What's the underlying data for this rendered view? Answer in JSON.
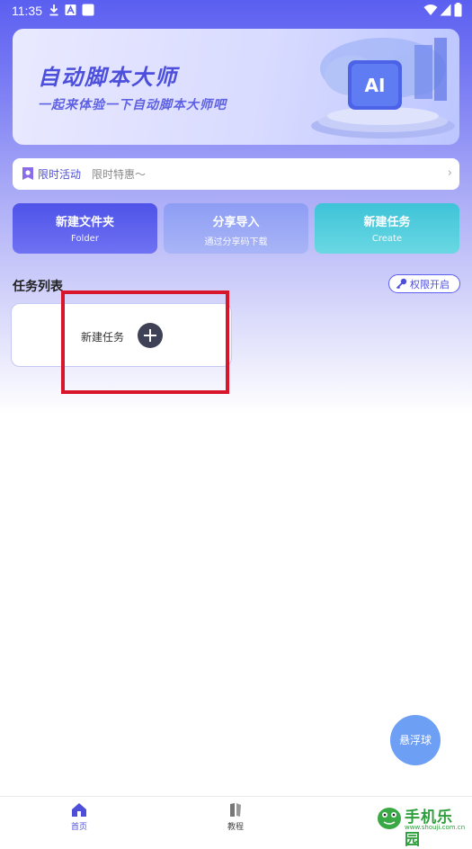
{
  "status_bar": {
    "time": "11:35"
  },
  "banner": {
    "title": "自动脚本大师",
    "subtitle": "一起来体验一下自动脚本大师吧",
    "art_label": "AI"
  },
  "promo": {
    "label": "限时活动",
    "text": "限时特惠～",
    "chevron": "›"
  },
  "actions": [
    {
      "title": "新建文件夹",
      "subtitle": "Folder",
      "color": "#5b5ff0"
    },
    {
      "title": "分享导入",
      "subtitle": "通过分享码下载",
      "color": "#8c9bf3"
    },
    {
      "title": "新建任务",
      "subtitle": "Create",
      "color": "#49c7d8"
    }
  ],
  "tasks": {
    "section_title": "任务列表",
    "permission_label": "权限开启",
    "new_task_label": "新建任务"
  },
  "float_ball": {
    "label": "悬浮球"
  },
  "nav": {
    "items": [
      {
        "label": "首页",
        "icon": "home-icon",
        "active": true
      },
      {
        "label": "教程",
        "icon": "book-icon",
        "active": false
      }
    ]
  },
  "watermark": {
    "text": "手机乐园",
    "url": "www.shouji.com.cn"
  },
  "colors": {
    "accent": "#5b5ff0",
    "highlight": "#d9152b",
    "float": "#6d9ff5"
  }
}
